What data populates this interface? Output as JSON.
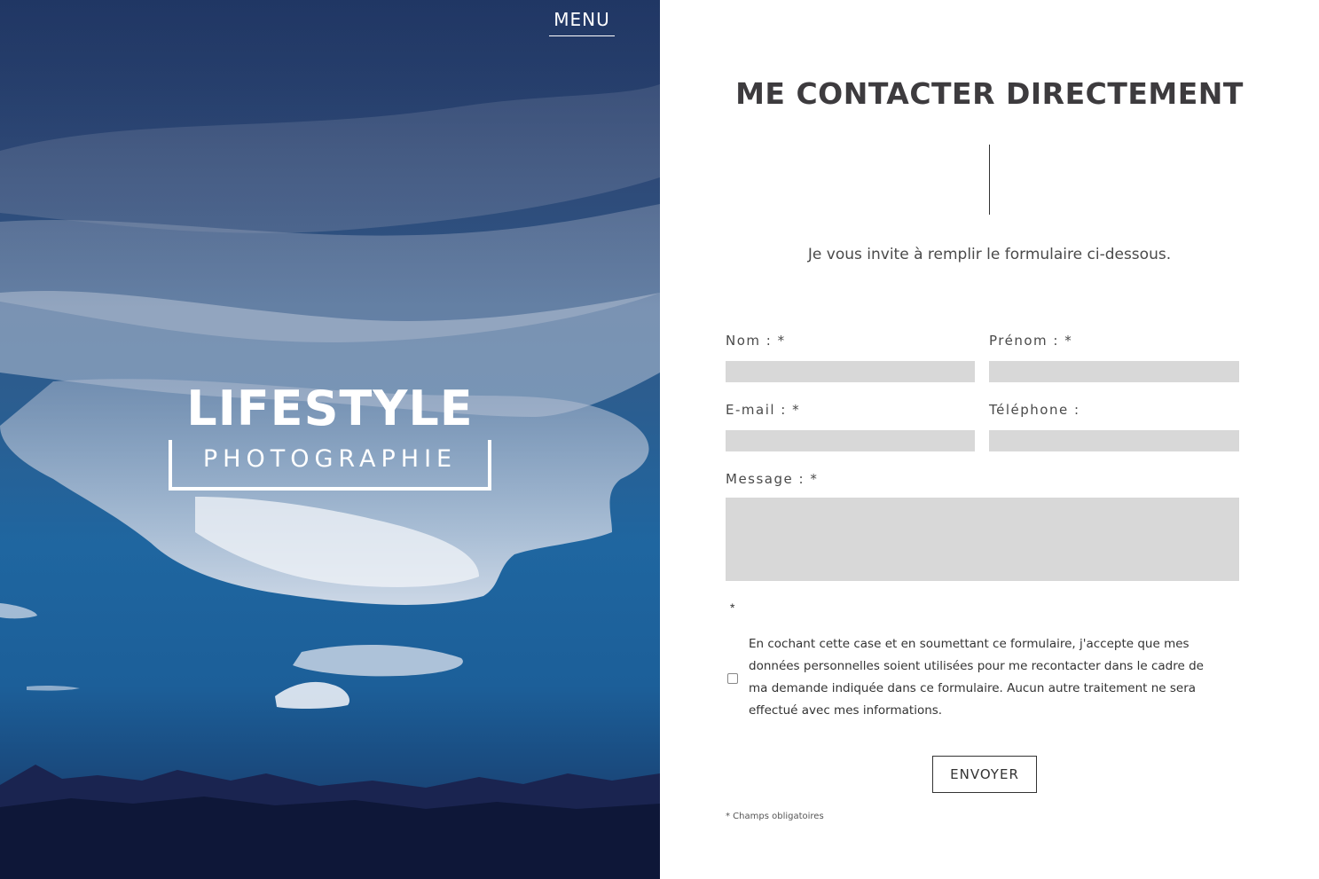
{
  "nav": {
    "menu_label": "MENU"
  },
  "brand": {
    "title": "LIFESTYLE",
    "subtitle": "PHOTOGRAPHIE"
  },
  "contact": {
    "title": "ME CONTACTER DIRECTEMENT",
    "intro": "Je vous invite à remplir le formulaire ci-dessous."
  },
  "form": {
    "nom_label": "Nom : *",
    "prenom_label": "Prénom : *",
    "email_label": "E-mail : *",
    "telephone_label": "Téléphone :",
    "message_label": "Message : *",
    "nom_value": "",
    "prenom_value": "",
    "email_value": "",
    "telephone_value": "",
    "message_value": "",
    "consent_star": "*",
    "consent_text": "En cochant cette case et en soumettant ce formulaire, j'accepte que mes données personnelles soient utilisées pour me recontacter dans le cadre de ma demande indiquée dans ce formulaire. Aucun autre traitement ne sera effectué avec mes informations.",
    "consent_checked": false,
    "submit_label": "ENVOYER",
    "required_note": "* Champs obligatoires"
  },
  "colors": {
    "input_bg": "#d8d8d8",
    "title_color": "#3d3b3e",
    "hero_sky": "#1f66a0",
    "mountains": "#0e1738"
  }
}
